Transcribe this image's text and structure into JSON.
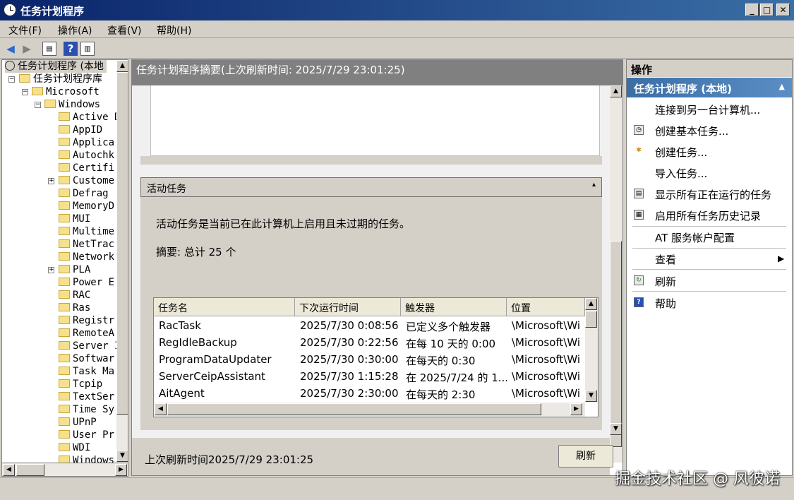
{
  "window": {
    "title": "任务计划程序",
    "min": "_",
    "max": "□",
    "close": "✕"
  },
  "menu": [
    "文件(F)",
    "操作(A)",
    "查看(V)",
    "帮助(H)"
  ],
  "tree": {
    "root": "任务计划程序 (本地",
    "library": "任务计划程序库",
    "microsoft": "Microsoft",
    "windows": "Windows",
    "children": [
      "Active D",
      "AppID",
      "Applica",
      "Autochk",
      "Certifi",
      "Custome",
      "Defrag",
      "MemoryD",
      "MUI",
      "Multime",
      "NetTrac",
      "Network",
      "PLA",
      "Power E",
      "RAC",
      "Ras",
      "Registr",
      "RemoteA",
      "Server I",
      "Softwar",
      "Task Ma",
      "Tcpip",
      "TextSer",
      "Time Sy",
      "UPnP",
      "User Pr",
      "WDI",
      "Windows"
    ]
  },
  "center": {
    "summary_header": "任务计划程序摘要(上次刷新时间: 2025/7/29 23:01:25)",
    "active_title": "活动任务",
    "active_desc": "活动任务是当前已在此计算机上启用且未过期的任务。",
    "summary": "摘要: 总计 25 个",
    "columns": [
      "任务名",
      "下次运行时间",
      "触发器",
      "位置"
    ],
    "rows": [
      [
        "RacTask",
        "2025/7/30 0:08:56",
        "已定义多个触发器",
        "\\Microsoft\\Wi"
      ],
      [
        "RegIdleBackup",
        "2025/7/30 0:22:56",
        "在每 10 天的 0:00",
        "\\Microsoft\\Wi"
      ],
      [
        "ProgramDataUpdater",
        "2025/7/30 0:30:00",
        "在每天的 0:30",
        "\\Microsoft\\Wi"
      ],
      [
        "ServerCeipAssistant",
        "2025/7/30 1:15:28",
        "在 2025/7/24 的 1...",
        "\\Microsoft\\Wi"
      ],
      [
        "AitAgent",
        "2025/7/30 2:30:00",
        "在每天的 2:30",
        "\\Microsoft\\Wi"
      ]
    ],
    "last_refresh": "上次刷新时间2025/7/29 23:01:25",
    "refresh_button": "刷新"
  },
  "actions": {
    "title": "操作",
    "section": "任务计划程序 (本地)",
    "items": [
      "连接到另一台计算机...",
      "创建基本任务...",
      "创建任务...",
      "导入任务...",
      "显示所有正在运行的任务",
      "启用所有任务历史记录",
      "AT 服务帐户配置",
      "查看",
      "刷新",
      "帮助"
    ]
  },
  "watermark": "掘金技术社区 @ 风彼诺"
}
